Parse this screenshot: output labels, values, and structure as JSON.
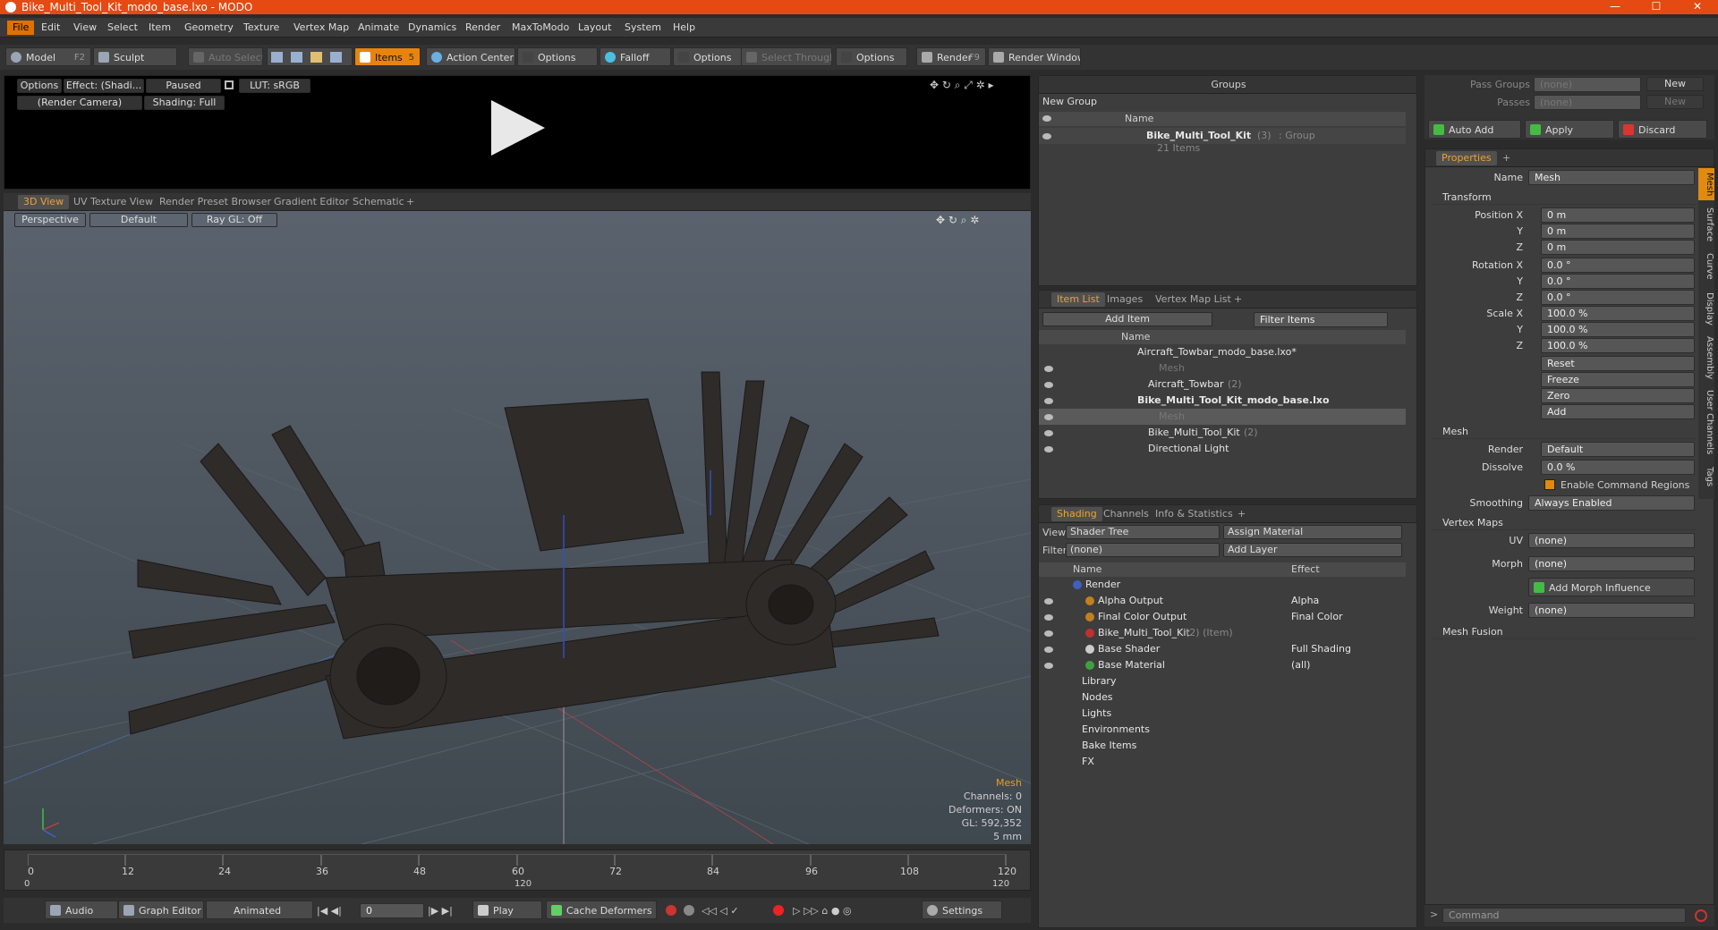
{
  "app": {
    "title": "Bike_Multi_Tool_Kit_modo_base.lxo - MODO",
    "window_controls": [
      "—",
      "☐",
      "✕"
    ]
  },
  "menu": [
    "File",
    "Edit",
    "View",
    "Select",
    "Item",
    "Geometry",
    "Texture",
    "Vertex Map",
    "Animate",
    "Dynamics",
    "Render",
    "MaxToModo",
    "Layout",
    "System",
    "Help"
  ],
  "toolbar": {
    "model": "Model",
    "model_key": "F2",
    "sculpt": "Sculpt",
    "auto_select": "Auto Select",
    "items": "Items",
    "items_key": "5",
    "action_center": "Action Center",
    "options1": "Options",
    "falloff": "Falloff",
    "options2": "Options",
    "select_through": "Select Through",
    "options3": "Options",
    "render": "Render",
    "render_key": "F9",
    "render_window": "Render Window"
  },
  "preview": {
    "options": "Options",
    "effect": "Effect: (Shadi...",
    "paused": "Paused",
    "lut": "LUT: sRGB",
    "camera": "(Render Camera)",
    "shading": "Shading: Full"
  },
  "viewport_tabs": [
    "3D View",
    "UV Texture View",
    "Render Preset Browser",
    "Gradient Editor",
    "Schematic",
    "+"
  ],
  "viewport": {
    "perspective": "Perspective",
    "default": "Default",
    "raygl": "Ray GL: Off",
    "info": {
      "mesh": "Mesh",
      "channels": "Channels: 0",
      "deformers": "Deformers: ON",
      "gl": "GL: 592,352",
      "unit": "5 mm"
    }
  },
  "timeline": {
    "ticks": [
      "0",
      "12",
      "24",
      "36",
      "48",
      "60",
      "72",
      "84",
      "96",
      "108",
      "120"
    ],
    "lower": [
      "0",
      "120",
      "120"
    ]
  },
  "transport": {
    "audio": "Audio",
    "graph_editor": "Graph Editor",
    "animated": "Animated",
    "frame": "0",
    "play": "Play",
    "cache": "Cache Deformers",
    "settings": "Settings"
  },
  "groups": {
    "title": "Groups",
    "new_group": "New Group",
    "col_name": "Name",
    "item_name": "Bike_Multi_Tool_Kit",
    "item_count": "(3)",
    "item_type": ": Group",
    "item_sub": "21 Items"
  },
  "item_list": {
    "tabs": [
      "Item List",
      "Images",
      "Vertex Map List",
      "+"
    ],
    "add_item": "Add Item",
    "filter": "Filter Items",
    "col_name": "Name",
    "rows": [
      {
        "name": "Aircraft_Towbar_modo_base.lxo*",
        "extra": "",
        "indent": 0
      },
      {
        "name": "Mesh",
        "extra": "",
        "indent": 2
      },
      {
        "name": "Aircraft_Towbar",
        "extra": "(2)",
        "indent": 1
      },
      {
        "name": "Bike_Multi_Tool_Kit_modo_base.lxo",
        "extra": "",
        "indent": 0
      },
      {
        "name": "Mesh",
        "extra": "",
        "indent": 2
      },
      {
        "name": "Bike_Multi_Tool_Kit",
        "extra": "(2)",
        "indent": 1
      },
      {
        "name": "Directional Light",
        "extra": "",
        "indent": 1
      }
    ]
  },
  "shading": {
    "tabs": [
      "Shading",
      "Channels",
      "Info & Statistics",
      "+"
    ],
    "view_label": "View",
    "view_value": "Shader Tree",
    "assign": "Assign Material",
    "filter_label": "Filter",
    "filter_value": "(none)",
    "add_layer": "Add Layer",
    "col_name": "Name",
    "col_effect": "Effect",
    "rows": [
      {
        "name": "Render",
        "extra": "",
        "effect": ""
      },
      {
        "name": "Alpha Output",
        "extra": "",
        "effect": "Alpha"
      },
      {
        "name": "Final Color Output",
        "extra": "",
        "effect": "Final Color"
      },
      {
        "name": "Bike_Multi_Tool_Kit",
        "extra": "(2) (Item)",
        "effect": ""
      },
      {
        "name": "Base Shader",
        "extra": "",
        "effect": "Full Shading"
      },
      {
        "name": "Base Material",
        "extra": "",
        "effect": "(all)"
      },
      {
        "name": "Library",
        "extra": "",
        "effect": ""
      },
      {
        "name": "Nodes",
        "extra": "",
        "effect": ""
      },
      {
        "name": "Lights",
        "extra": "",
        "effect": ""
      },
      {
        "name": "Environments",
        "extra": "",
        "effect": ""
      },
      {
        "name": "Bake Items",
        "extra": "",
        "effect": ""
      },
      {
        "name": "FX",
        "extra": "",
        "effect": ""
      }
    ]
  },
  "props": {
    "pass_groups": "Pass Groups",
    "passes": "Passes",
    "none": "(none)",
    "new": "New",
    "auto_add": "Auto Add",
    "apply": "Apply",
    "discard": "Discard",
    "tab": "Properties",
    "name_label": "Name",
    "name_value": "Mesh",
    "transform": "Transform",
    "position_label": "Position X",
    "rotation_label": "Rotation X",
    "scale_label": "Scale X",
    "y": "Y",
    "z": "Z",
    "pos": [
      "0 m",
      "0 m",
      "0 m"
    ],
    "rot": [
      "0.0 °",
      "0.0 °",
      "0.0 °"
    ],
    "scale": [
      "100.0 %",
      "100.0 %",
      "100.0 %"
    ],
    "reset": "Reset",
    "freeze": "Freeze",
    "zero": "Zero",
    "add": "Add",
    "mesh": "Mesh",
    "render_label": "Render",
    "render_value": "Default",
    "dissolve_label": "Dissolve",
    "dissolve_value": "0.0 %",
    "enable_cmd": "Enable Command Regions",
    "smoothing_label": "Smoothing",
    "smoothing_value": "Always Enabled",
    "vertex_maps": "Vertex Maps",
    "uv_label": "UV",
    "morph_label": "Morph",
    "add_morph": "Add Morph Influence",
    "weight_label": "Weight",
    "mesh_fusion": "Mesh Fusion",
    "side_tabs": [
      "Mesh",
      "Surface",
      "Curve",
      "Display",
      "Assembly",
      "User Channels",
      "Tags"
    ],
    "command": "Command"
  }
}
